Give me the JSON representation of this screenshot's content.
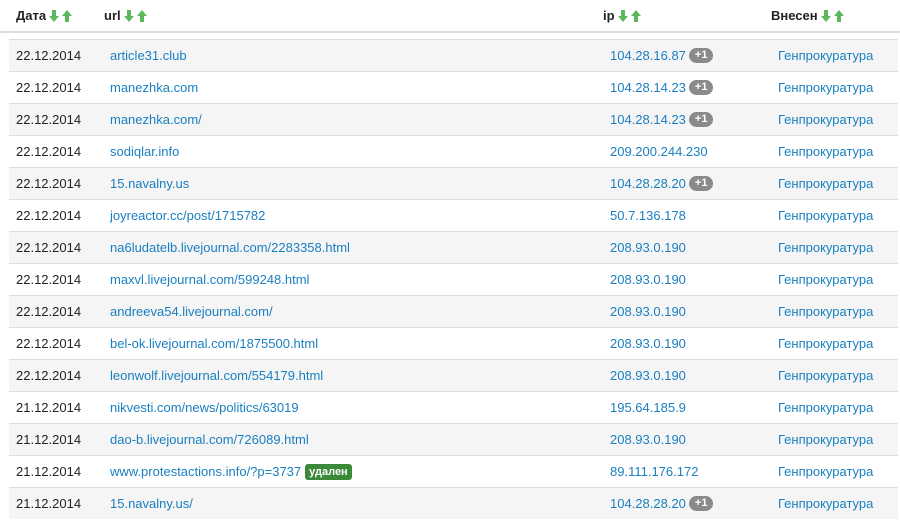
{
  "table": {
    "columns": [
      {
        "label": "Дата"
      },
      {
        "label": "url"
      },
      {
        "label": "ip"
      },
      {
        "label": "Внесен"
      }
    ],
    "sort_down_icon": "arrow-down-icon",
    "sort_up_icon": "arrow-up-icon",
    "colors": {
      "link": "#1a7fc1",
      "sort_arrow": "#5cb85c",
      "badge": "#8a8a8a",
      "removed_label": "#3a8a3a",
      "stripe": "#f5f5f5"
    },
    "rows": [
      {
        "date": "22.12.2014",
        "url": "article31.club",
        "ip": "104.28.16.87",
        "ip_badge": "+1",
        "by": "Генпрокуратура"
      },
      {
        "date": "22.12.2014",
        "url": "manezhka.com",
        "ip": "104.28.14.23",
        "ip_badge": "+1",
        "by": "Генпрокуратура"
      },
      {
        "date": "22.12.2014",
        "url": "manezhka.com/",
        "ip": "104.28.14.23",
        "ip_badge": "+1",
        "by": "Генпрокуратура"
      },
      {
        "date": "22.12.2014",
        "url": "sodiqlar.info",
        "ip": "209.200.244.230",
        "by": "Генпрокуратура"
      },
      {
        "date": "22.12.2014",
        "url": "15.navalny.us",
        "ip": "104.28.28.20",
        "ip_badge": "+1",
        "by": "Генпрокуратура"
      },
      {
        "date": "22.12.2014",
        "url": "joyreactor.cc/post/1715782",
        "ip": "50.7.136.178",
        "by": "Генпрокуратура"
      },
      {
        "date": "22.12.2014",
        "url": "na6ludatelb.livejournal.com/2283358.html",
        "ip": "208.93.0.190",
        "by": "Генпрокуратура"
      },
      {
        "date": "22.12.2014",
        "url": "maxvl.livejournal.com/599248.html",
        "ip": "208.93.0.190",
        "by": "Генпрокуратура"
      },
      {
        "date": "22.12.2014",
        "url": "andreeva54.livejournal.com/",
        "ip": "208.93.0.190",
        "by": "Генпрокуратура"
      },
      {
        "date": "22.12.2014",
        "url": "bel-ok.livejournal.com/1875500.html",
        "ip": "208.93.0.190",
        "by": "Генпрокуратура"
      },
      {
        "date": "22.12.2014",
        "url": "leonwolf.livejournal.com/554179.html",
        "ip": "208.93.0.190",
        "by": "Генпрокуратура"
      },
      {
        "date": "21.12.2014",
        "url": "nikvesti.com/news/politics/63019",
        "ip": "195.64.185.9",
        "by": "Генпрокуратура"
      },
      {
        "date": "21.12.2014",
        "url": "dao-b.livejournal.com/726089.html",
        "ip": "208.93.0.190",
        "by": "Генпрокуратура"
      },
      {
        "date": "21.12.2014",
        "url": "www.protestactions.info/?p=3737",
        "url_label": "удален",
        "ip": "89.111.176.172",
        "by": "Генпрокуратура"
      },
      {
        "date": "21.12.2014",
        "url": "15.navalny.us/",
        "ip": "104.28.28.20",
        "ip_badge": "+1",
        "by": "Генпрокуратура"
      }
    ]
  }
}
